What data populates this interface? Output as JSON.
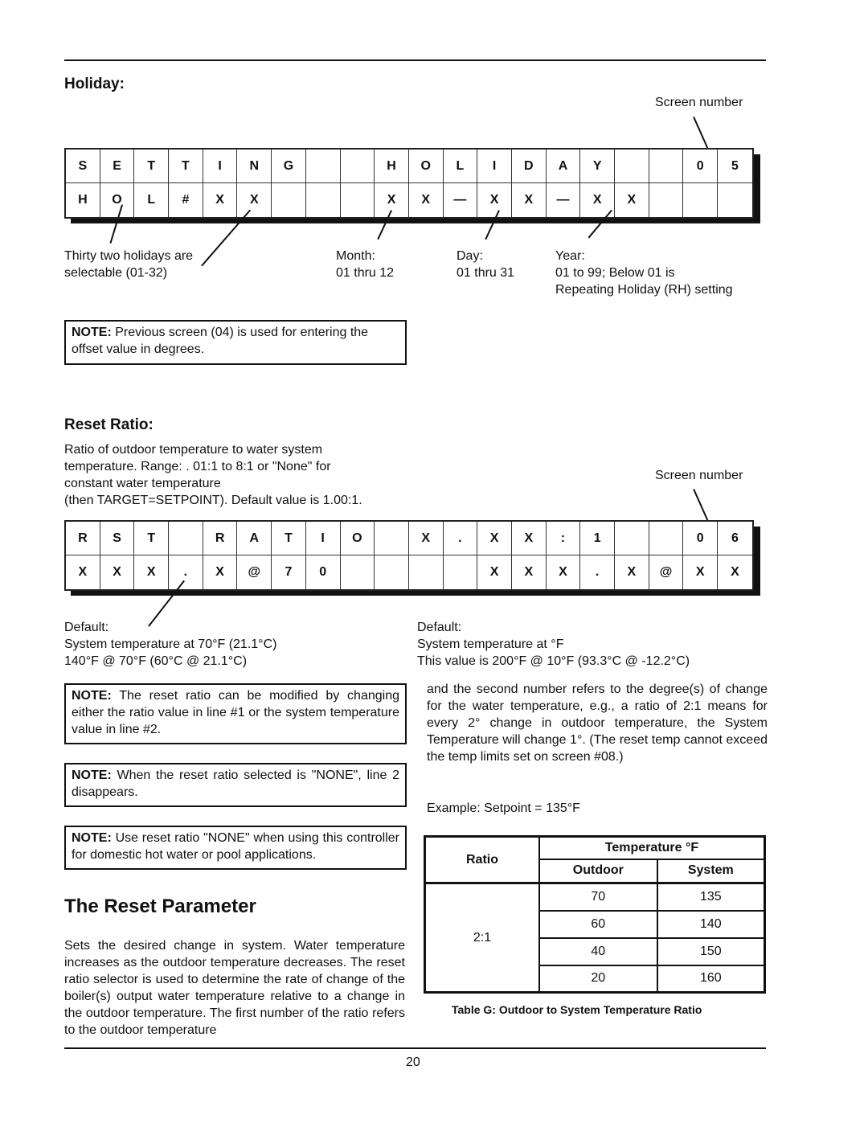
{
  "holiday": {
    "heading": "Holiday:",
    "screen_number_label": "Screen number",
    "lcd_row1": [
      "S",
      "E",
      "T",
      "T",
      "I",
      "N",
      "G",
      "",
      "",
      "H",
      "O",
      "L",
      "I",
      "D",
      "A",
      "Y",
      "",
      "",
      "0",
      "5"
    ],
    "lcd_row2": [
      "H",
      "O",
      "L",
      "#",
      "X",
      "X",
      "",
      "",
      "",
      "X",
      "X",
      "—",
      "X",
      "X",
      "—",
      "X",
      "X",
      "",
      "",
      ""
    ],
    "annotations": {
      "holidays_line1": "Thirty two holidays are",
      "holidays_line2": "selectable (01-32)",
      "month_line1": "Month:",
      "month_line2": "01 thru 12",
      "day_line1": "Day:",
      "day_line2": "01 thru 31",
      "year_line1": "Year:",
      "year_line2": "01 to 99; Below 01 is",
      "year_line3": "Repeating Holiday (RH) setting"
    },
    "note_label": "NOTE:",
    "note_text": " Previous screen (04) is used for entering the offset value in degrees."
  },
  "reset_ratio": {
    "heading": "Reset Ratio:",
    "description": [
      "Ratio of outdoor temperature to water system",
      "temperature.  Range: . 01:1 to 8:1 or \"None\" for",
      "constant water temperature",
      "(then TARGET=SETPOINT).  Default value is 1.00:1."
    ],
    "screen_number_label": "Screen number",
    "lcd_row1": [
      "R",
      "S",
      "T",
      "",
      "R",
      "A",
      "T",
      "I",
      "O",
      "",
      "X",
      ".",
      "X",
      "X",
      ":",
      "1",
      "",
      "",
      "0",
      "6"
    ],
    "lcd_row2": [
      "X",
      "X",
      "X",
      ".",
      "X",
      "@",
      "7",
      "0",
      "",
      "",
      "",
      "",
      "X",
      "X",
      "X",
      ".",
      "X",
      "@",
      "X",
      "X"
    ],
    "default_left": {
      "line1": "Default:",
      "line2": "System temperature at 70°F (21.1°C)",
      "line3": "140°F @ 70°F (60°C @ 21.1°C)"
    },
    "default_right": {
      "line1": "Default:",
      "line2": "System temperature at °F",
      "line3": "This value is 200°F @ 10°F (93.3°C @ -12.2°C)"
    },
    "notes": [
      {
        "label": "NOTE:",
        "text": " The reset ratio can be modified by changing either the ratio value in line #1 or the system temperature value in line #2."
      },
      {
        "label": "NOTE:",
        "text": " When the reset ratio selected is \"NONE\", line 2 disappears."
      },
      {
        "label": "NOTE:",
        "text": " Use reset ratio \"NONE\" when using this controller for domestic hot water or pool applications."
      }
    ],
    "right_paragraph": "and the second number refers to the degree(s) of change for the water temperature, e.g., a ratio of 2:1 means for every 2° change in outdoor temperature, the System Temperature will change 1°. (The reset temp cannot exceed the temp limits set on screen #08.)",
    "example": "Example: Setpoint = 135°F"
  },
  "reset_parameter": {
    "heading": "The Reset Parameter",
    "paragraph": "Sets the desired change in system. Water temperature increases as the outdoor temperature decreases. The reset ratio selector is used to determine the rate of change of the boiler(s) output water temperature relative to a change in the outdoor temperature. The first number of the ratio refers to the outdoor temperature"
  },
  "table_g": {
    "header_ratio": "Ratio",
    "header_temperature": "Temperature °F",
    "header_outdoor": "Outdoor",
    "header_system": "System",
    "ratio_value": "2:1",
    "rows": [
      {
        "outdoor": "70",
        "system": "135"
      },
      {
        "outdoor": "60",
        "system": "140"
      },
      {
        "outdoor": "40",
        "system": "150"
      },
      {
        "outdoor": "20",
        "system": "160"
      }
    ],
    "caption": "Table G: Outdoor to System Temperature Ratio"
  },
  "footer": {
    "page_number": "20"
  }
}
